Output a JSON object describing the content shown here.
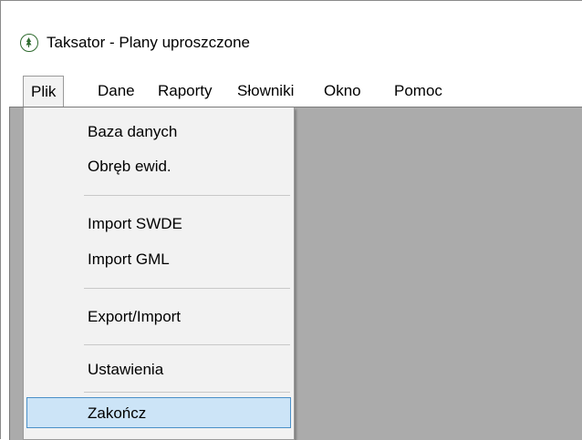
{
  "window": {
    "title": "Taksator - Plany uproszczone",
    "app_icon": "tree-logo-icon"
  },
  "menubar": {
    "items": [
      {
        "label": "Plik",
        "open": true
      },
      {
        "label": "Dane"
      },
      {
        "label": "Raporty"
      },
      {
        "label": "Słowniki"
      },
      {
        "label": "Okno"
      },
      {
        "label": "Pomoc"
      }
    ]
  },
  "file_menu": {
    "items": [
      {
        "label": "Baza danych"
      },
      {
        "label": "Obręb ewid."
      },
      {
        "label": "Import SWDE"
      },
      {
        "label": "Import GML"
      },
      {
        "label": "Export/Import"
      },
      {
        "label": "Ustawienia"
      },
      {
        "label": "Zakończ",
        "selected": true
      }
    ]
  },
  "colors": {
    "workspace": "#ababab",
    "menu_background": "#f2f2f2",
    "selection_fill": "#cce4f7",
    "selection_border": "#4a90c8"
  }
}
